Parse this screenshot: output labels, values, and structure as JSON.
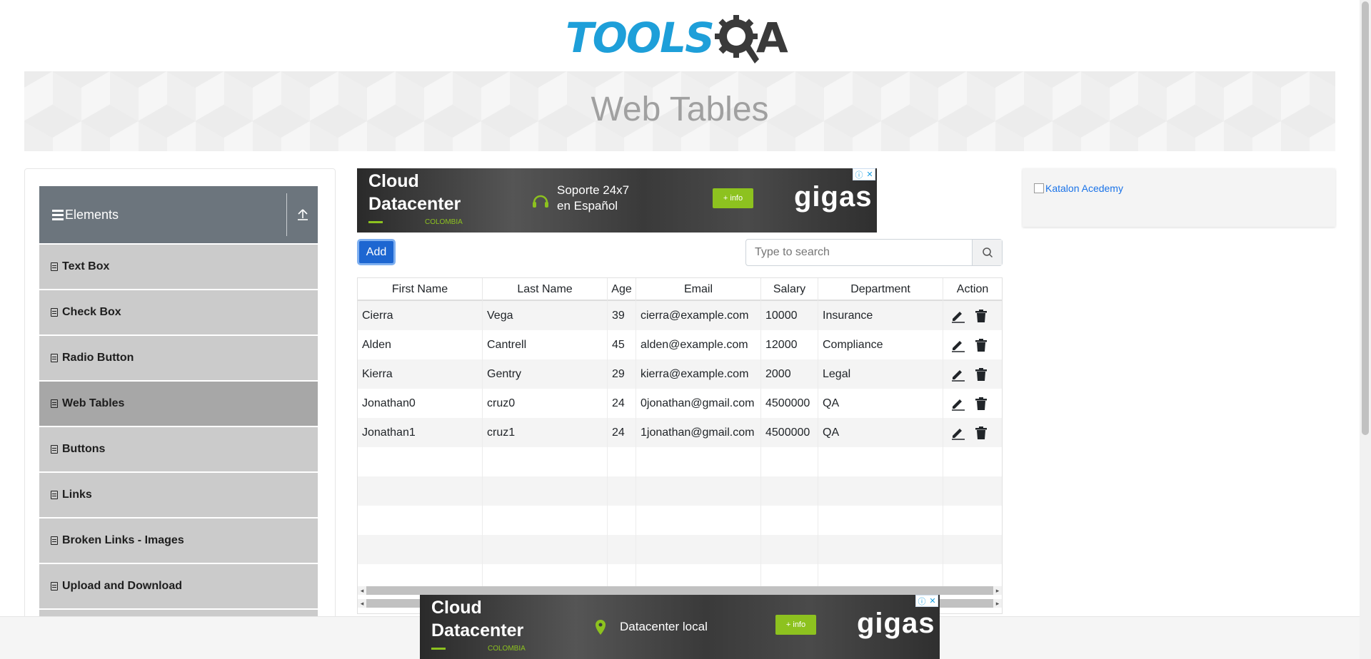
{
  "logo": {
    "text_primary": "TOOLS",
    "text_secondary": "A"
  },
  "banner": {
    "title": "Web Tables"
  },
  "sidebar": {
    "group_title": "Elements",
    "items": [
      {
        "label": "Text Box",
        "active": false
      },
      {
        "label": "Check Box",
        "active": false
      },
      {
        "label": "Radio Button",
        "active": false
      },
      {
        "label": "Web Tables",
        "active": true
      },
      {
        "label": "Buttons",
        "active": false
      },
      {
        "label": "Links",
        "active": false
      },
      {
        "label": "Broken Links - Images",
        "active": false
      },
      {
        "label": "Upload and Download",
        "active": false
      }
    ]
  },
  "ad_top": {
    "headline_1": "Cloud",
    "headline_2": "Datacenter",
    "country": "COLOMBIA",
    "support_1": "Soporte 24x7",
    "support_2": "en Español",
    "cta": "+ info",
    "brand": "gigas"
  },
  "ad_bottom": {
    "headline_1": "Cloud",
    "headline_2": "Datacenter",
    "country": "COLOMBIA",
    "feature": "Datacenter local",
    "cta": "+ info",
    "brand": "gigas"
  },
  "toolbar": {
    "add_label": "Add",
    "search_placeholder": "Type to search"
  },
  "table": {
    "headers": [
      "First Name",
      "Last Name",
      "Age",
      "Email",
      "Salary",
      "Department",
      "Action"
    ],
    "rows": [
      [
        "Cierra",
        "Vega",
        "39",
        "cierra@example.com",
        "10000",
        "Insurance"
      ],
      [
        "Alden",
        "Cantrell",
        "45",
        "alden@example.com",
        "12000",
        "Compliance"
      ],
      [
        "Kierra",
        "Gentry",
        "29",
        "kierra@example.com",
        "2000",
        "Legal"
      ],
      [
        "Jonathan0",
        "cruz0",
        "24",
        "0jonathan@gmail.com",
        "4500000",
        "QA"
      ],
      [
        "Jonathan1",
        "cruz1",
        "24",
        "1jonathan@gmail.com",
        "4500000",
        "QA"
      ]
    ],
    "empty_rows": 5
  },
  "right_ad": {
    "alt_text": "Katalon Acedemy"
  },
  "colors": {
    "primary_button": "#1d66d1",
    "sidebar_header": "#6c757d",
    "active_item": "#a7a7a7",
    "logo_blue": "#1e9fd9",
    "ad_green": "#8dc21f"
  }
}
